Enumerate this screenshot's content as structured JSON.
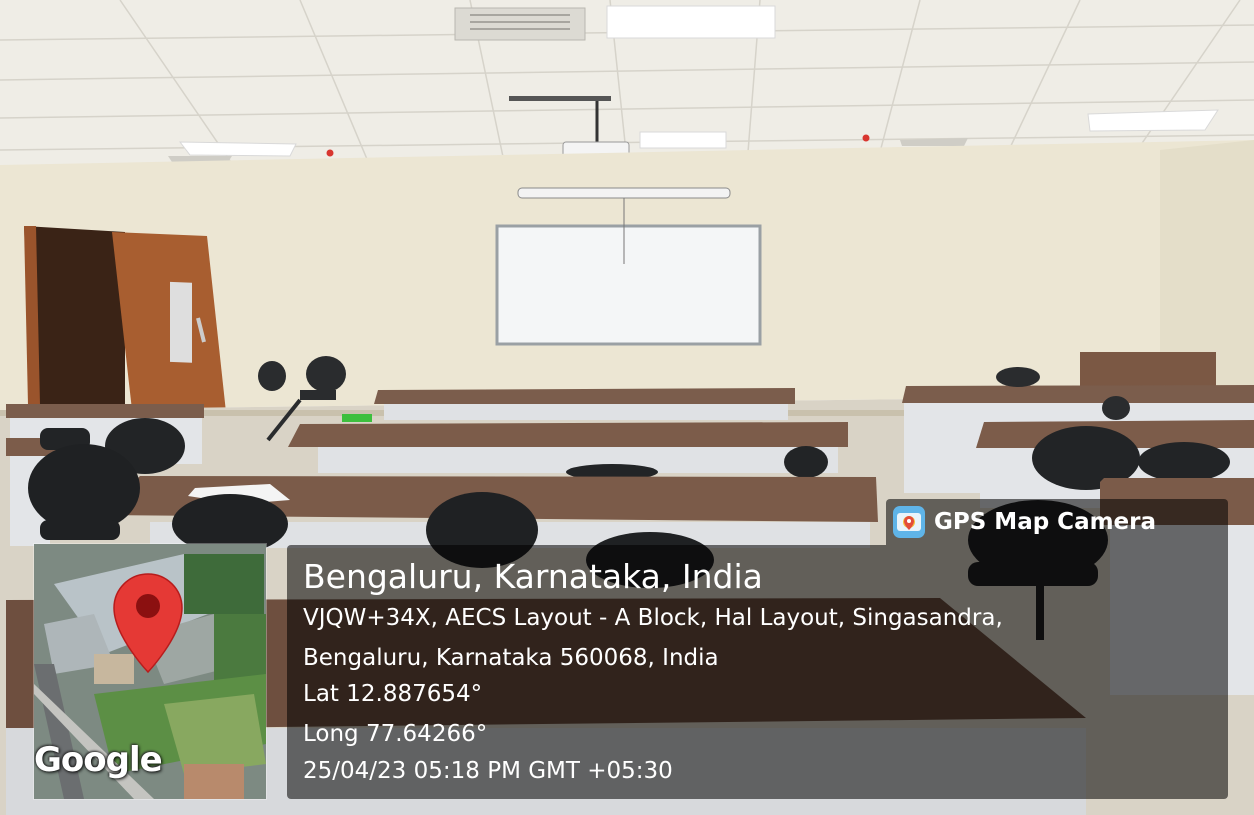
{
  "overlay": {
    "app_name": "GPS Map Camera",
    "app_icon": "map-camera-icon",
    "location_title": "Bengaluru, Karnataka, India",
    "address_line_1": "VJQW+34X, AECS Layout - A Block, Hal Layout, Singasandra,",
    "address_line_2": "Bengaluru, Karnataka 560068, India",
    "latitude": "Lat 12.887654°",
    "longitude": "Long 77.64266°",
    "timestamp": "25/04/23 05:18 PM GMT +05:30"
  },
  "map_thumbnail": {
    "watermark": "Google",
    "pin_icon": "map-pin-icon",
    "pin_color": "#e53935"
  },
  "colors": {
    "wall": "#ece6d2",
    "ceiling": "#f1efe8",
    "desk_top": "#7a5a48",
    "chair": "#222426",
    "door": "#a65a2e",
    "overlay_bg": "#000000"
  }
}
